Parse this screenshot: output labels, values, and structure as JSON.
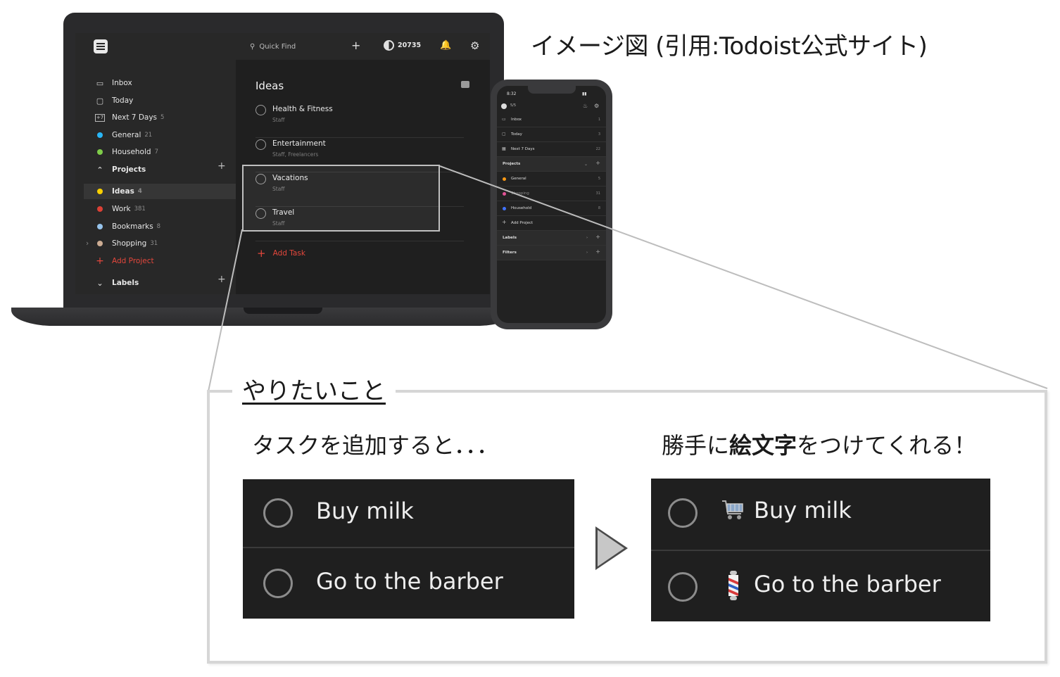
{
  "caption": "イメージ図 (引用:Todoist公式サイト)",
  "desktop": {
    "topbar": {
      "quick_find": "Quick Find",
      "karma": "20735"
    },
    "sidebar": {
      "inbox": "Inbox",
      "today": "Today",
      "next7": {
        "label": "Next 7 Days",
        "count": "5",
        "icon_text": "+7"
      },
      "general": {
        "label": "General",
        "count": "21",
        "color": "#29b6f6"
      },
      "household": {
        "label": "Household",
        "count": "7",
        "color": "#7ecc49"
      },
      "projects_header": "Projects",
      "projects": [
        {
          "label": "Ideas",
          "count": "4",
          "color": "#fad000"
        },
        {
          "label": "Work",
          "count": "381",
          "color": "#db4035"
        },
        {
          "label": "Bookmarks",
          "count": "8",
          "color": "#96c3eb"
        },
        {
          "label": "Shopping",
          "count": "31",
          "color": "#ccac93"
        }
      ],
      "add_project": "Add Project",
      "labels_header": "Labels"
    },
    "main": {
      "title": "Ideas",
      "tasks": [
        {
          "name": "Health & Fitness",
          "sub": "Staff"
        },
        {
          "name": "Entertainment",
          "sub": "Staff, Freelancers"
        },
        {
          "name": "Vacations",
          "sub": "Staff"
        },
        {
          "name": "Travel",
          "sub": "Staff"
        }
      ],
      "add_task": "Add Task"
    }
  },
  "mobile": {
    "time": "8:32",
    "header_count": "5/5",
    "rows": [
      {
        "label": "Inbox",
        "num": "1"
      },
      {
        "label": "Today",
        "num": "3"
      },
      {
        "label": "Next 7 Days",
        "num": "22"
      }
    ],
    "projects_header": "Projects",
    "projects": [
      {
        "label": "General",
        "num": "5",
        "color": "#ff9a14"
      },
      {
        "label": "Shopping",
        "num": "31",
        "color": "#e05194"
      },
      {
        "label": "Household",
        "num": "8",
        "color": "#4073ff"
      }
    ],
    "add_project": "Add Project",
    "labels": "Labels",
    "filters": "Filters"
  },
  "callout": {
    "title": "やりたいこと",
    "left_heading": "タスクを追加すると．．．",
    "right_heading_pre": "勝手に",
    "right_heading_bold": "絵文字",
    "right_heading_post": "をつけてくれる！",
    "before_tasks": [
      "Buy milk",
      "Go to the barber"
    ],
    "after_tasks": [
      "Buy milk",
      "Go to the barber"
    ],
    "after_emoji_icons": [
      "shopping-cart-icon",
      "barber-pole-icon"
    ]
  }
}
